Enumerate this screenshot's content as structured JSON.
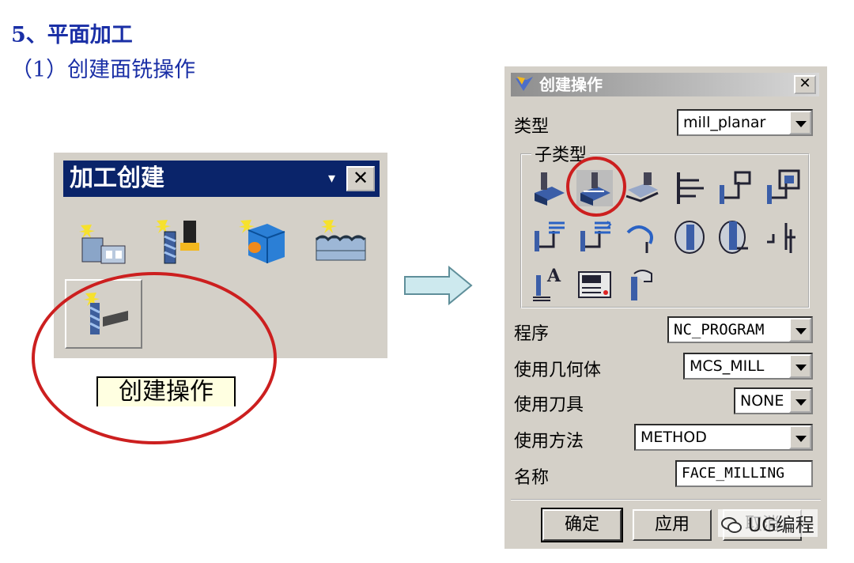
{
  "heading": "5、平面加工",
  "subheading": "（1）创建面铣操作",
  "toolbar": {
    "title": "加工创建",
    "dropdown_glyph": "▾",
    "close_glyph": "✕",
    "tooltip": "创建操作",
    "icons": [
      "create-program-icon",
      "create-tool-icon",
      "create-geometry-icon",
      "create-method-icon",
      "create-operation-icon"
    ]
  },
  "dialog": {
    "title": "创建操作",
    "close_glyph": "✕",
    "type_label": "类型",
    "type_value": "mill_planar",
    "subtype_label": "子类型",
    "program_label": "程序",
    "program_value": "NC_PROGRAM",
    "geometry_label": "使用几何体",
    "geometry_value": "MCS_MILL",
    "tool_label": "使用刀具",
    "tool_value": "NONE",
    "method_label": "使用方法",
    "method_value": "METHOD",
    "name_label": "名称",
    "name_value": "FACE_MILLING",
    "ok_label": "确定",
    "apply_label": "应用",
    "cancel_label": "取消"
  },
  "watermark": "UG编程",
  "colors": {
    "heading": "#1a2fa6",
    "highlight": "#cc1f1f",
    "titlebar": "#0a246a",
    "face": "#d4d0c8"
  }
}
